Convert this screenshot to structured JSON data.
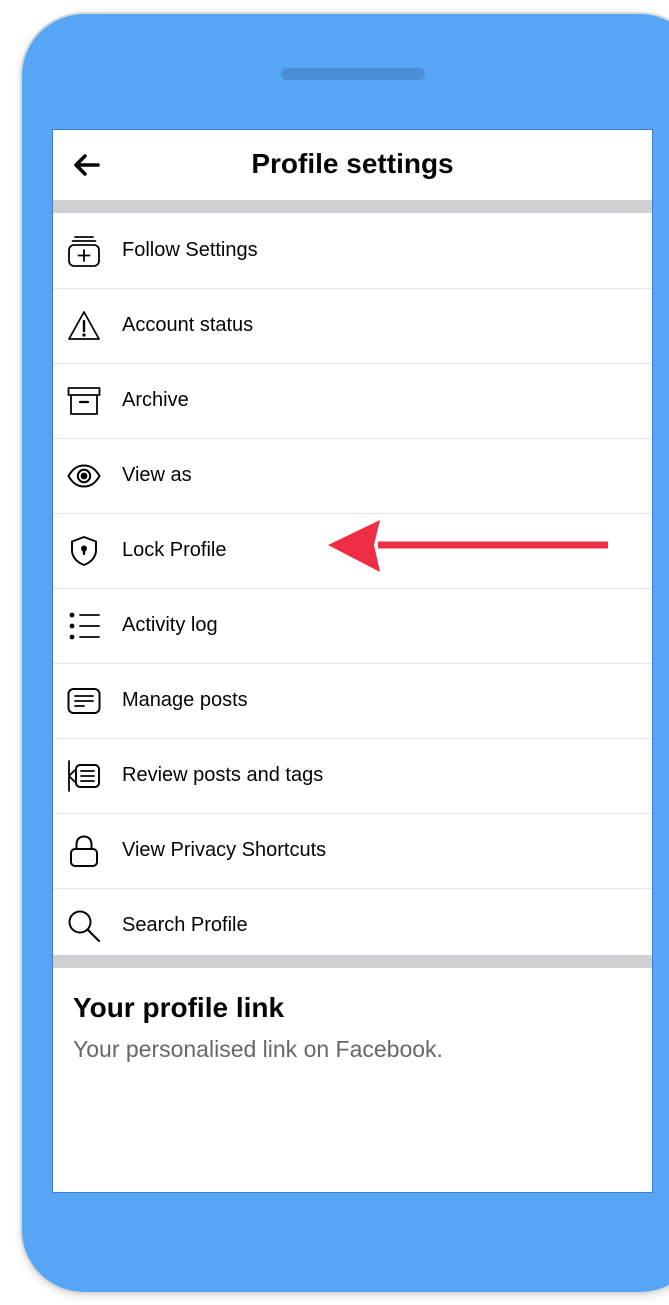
{
  "header": {
    "title": "Profile settings",
    "back_icon": "back-arrow-icon"
  },
  "menu": {
    "items": [
      {
        "label": "Follow Settings",
        "icon": "follow-settings-icon"
      },
      {
        "label": "Account status",
        "icon": "warning-icon"
      },
      {
        "label": "Archive",
        "icon": "archive-icon"
      },
      {
        "label": "View as",
        "icon": "eye-icon"
      },
      {
        "label": "Lock Profile",
        "icon": "shield-lock-icon"
      },
      {
        "label": "Activity log",
        "icon": "list-icon"
      },
      {
        "label": "Manage posts",
        "icon": "posts-icon"
      },
      {
        "label": "Review posts and tags",
        "icon": "review-tags-icon"
      },
      {
        "label": "View Privacy Shortcuts",
        "icon": "lock-icon"
      },
      {
        "label": "Search Profile",
        "icon": "search-icon"
      }
    ]
  },
  "profile_link": {
    "title": "Your profile link",
    "subtitle": "Your personalised link on Facebook."
  },
  "colors": {
    "phone_body": "#57a6f5",
    "annotation_arrow": "#ee2e45",
    "divider": "#ced0d4",
    "secondary_text": "#65676b"
  }
}
